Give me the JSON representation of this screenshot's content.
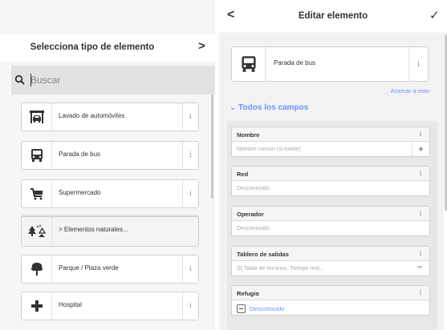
{
  "left_panel": {
    "title": "Selecciona tipo de elemento",
    "next_label": ">",
    "search": {
      "placeholder": "Buscar",
      "value": ""
    },
    "presets": [
      {
        "label": "Lavado de automóviles",
        "icon": "car-wash-icon",
        "info": "i"
      },
      {
        "label": "Parada de bus",
        "icon": "bus-icon",
        "info": "i"
      },
      {
        "label": "Supermercado",
        "icon": "shopping-cart-icon",
        "info": "i"
      },
      {
        "label": "> Elementos naturales...",
        "icon": "natural-features-icon",
        "group": true
      },
      {
        "label": "Parque / Plaza verde",
        "icon": "tree-icon",
        "info": "i"
      },
      {
        "label": "Hospital",
        "icon": "hospital-cross-icon",
        "info": "i"
      }
    ]
  },
  "right_panel": {
    "back_label": "<",
    "title": "Editar elemento",
    "done_label": "✓",
    "selected_preset": {
      "label": "Parada de bus",
      "icon": "bus-icon",
      "info": "i"
    },
    "zoom_link": "Acercar a esto",
    "fields_toggle": "Todos los campos",
    "fields": [
      {
        "label": "Nombre",
        "value": "",
        "placeholder": "Nombre común (si existe)",
        "info": "i",
        "add": "+"
      },
      {
        "label": "Red",
        "value": "",
        "placeholder": "Desconocido",
        "info": "i"
      },
      {
        "label": "Operador",
        "value": "",
        "placeholder": "Desconocido",
        "info": "i"
      },
      {
        "label": "Tablero de salidas",
        "value": "",
        "placeholder": "S( Tabla de horarios, Tiempo real...",
        "info": "i"
      },
      {
        "label": "Refugio",
        "check_label": "Desconocido",
        "info": "i"
      }
    ]
  },
  "colors": {
    "accent": "#7092ff",
    "panel_bg": "#f6f6f6",
    "field_area_bg": "#e8e8e8"
  }
}
